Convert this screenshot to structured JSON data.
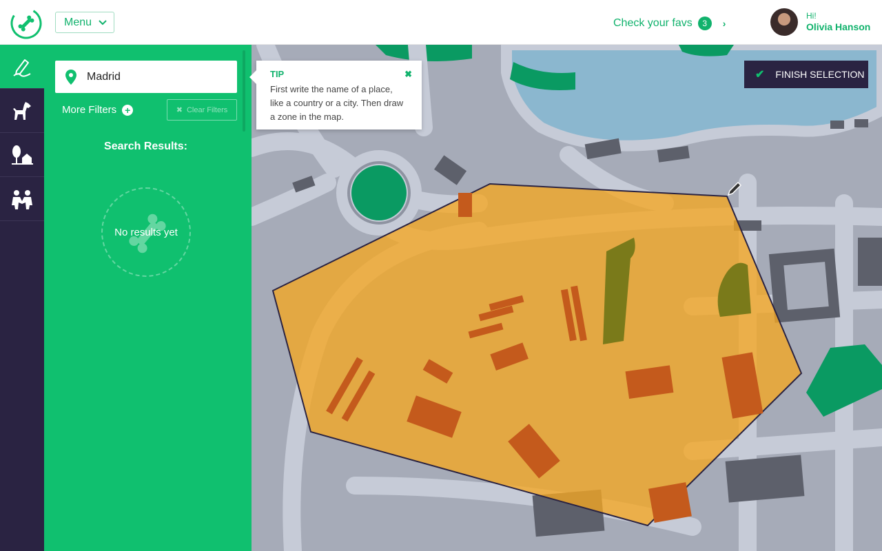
{
  "header": {
    "menu_label": "Menu",
    "favs_label": "Check your favs",
    "favs_count": "3",
    "greeting": "Hi!",
    "user_name": "Olivia Hanson"
  },
  "rail": {
    "items": [
      {
        "icon": "draw-zone-icon",
        "active": true
      },
      {
        "icon": "dog-icon",
        "active": false
      },
      {
        "icon": "park-house-icon",
        "active": false
      },
      {
        "icon": "people-icon",
        "active": false
      }
    ]
  },
  "panel": {
    "search_value": "Madrid",
    "more_filters": "More Filters",
    "clear_filters": "Clear Filters",
    "results_title": "Search Results:",
    "no_results": "No results yet"
  },
  "tip": {
    "title": "TIP",
    "body": "First write the name of a place, like a country or a city. Then draw a zone in the map."
  },
  "map": {
    "finish_label": "FINISH SELECTION"
  },
  "colors": {
    "brand_green": "#10c06f",
    "dark_purple": "#2a2342",
    "selection_fill": "#f5a623"
  }
}
